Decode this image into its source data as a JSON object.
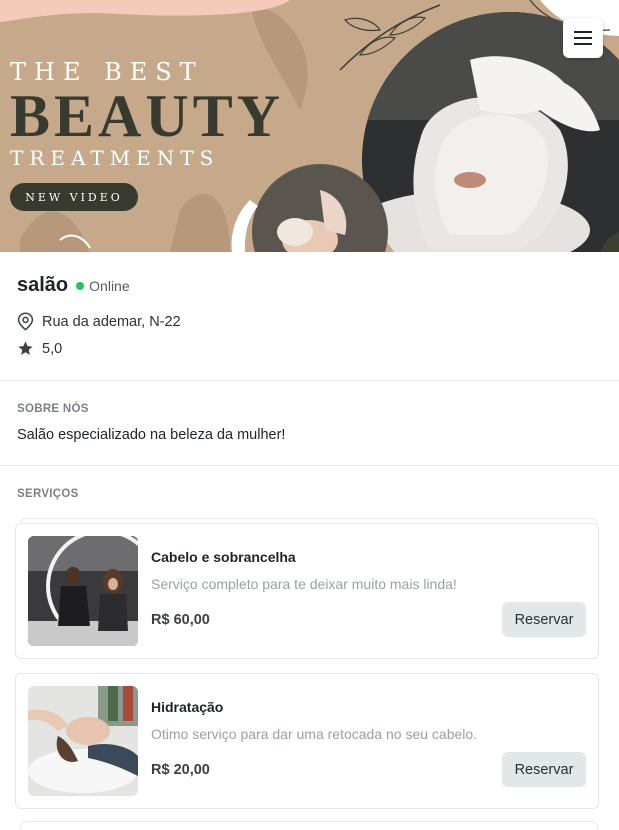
{
  "banner": {
    "line1": "THE BEST",
    "line2": "BEAUTY",
    "line3": "TREATMENTS",
    "video_button": "NEW VIDEO",
    "colors": {
      "background": "#c6a88a",
      "dark": "#383a30",
      "accent": "#f6cfc0"
    }
  },
  "header": {
    "menu_icon": "hamburger-icon"
  },
  "salon": {
    "name": "salão",
    "status": "Online",
    "status_color": "#22c55e",
    "address": "Rua da ademar, N-22",
    "rating": "5,0"
  },
  "about": {
    "label": "SOBRE NÓS",
    "text": "Salão especializado na beleza da mulher!"
  },
  "services": {
    "label": "SERVIÇOS",
    "items": [
      {
        "title": "Cabelo e sobrancelha",
        "description": "Serviço completo para te deixar muito mais linda!",
        "price": "R$ 60,00",
        "button": "Reservar"
      },
      {
        "title": "Hidratação",
        "description": "Otimo serviço para dar uma retocada no seu cabelo.",
        "price": "R$ 20,00",
        "button": "Reservar"
      }
    ]
  }
}
